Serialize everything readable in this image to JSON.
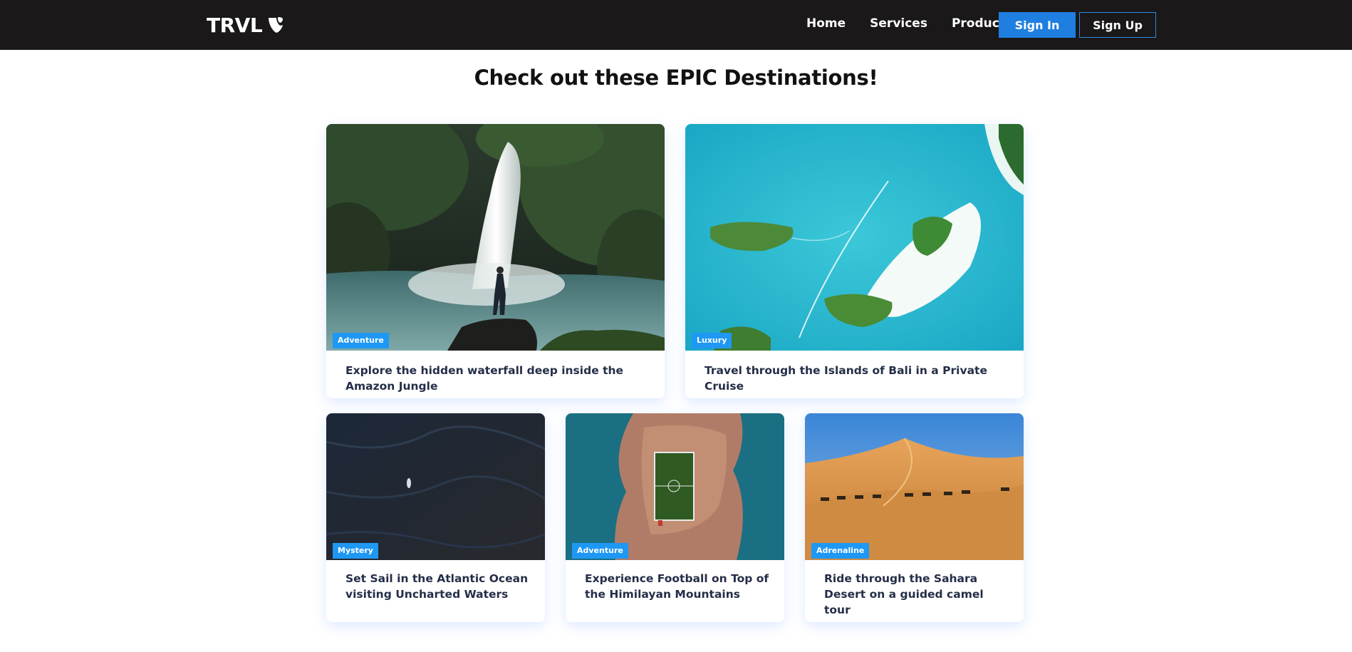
{
  "navbar": {
    "logo_text": "TRVL",
    "logo_icon": "typo3-shield-icon",
    "links": [
      "Home",
      "Services",
      "Products"
    ],
    "sign_in": "Sign In",
    "sign_up": "Sign Up",
    "colors": {
      "background": "#1a1818",
      "accent": "#1f7fe0"
    }
  },
  "main": {
    "heading": "Check out these EPIC Destinations!"
  },
  "cards": [
    {
      "category": "Adventure",
      "text": "Explore the hidden waterfall deep inside the Amazon Jungle",
      "image": "waterfall-jungle"
    },
    {
      "category": "Luxury",
      "text": "Travel through the Islands of Bali in a Private Cruise",
      "image": "bali-islands-aerial"
    },
    {
      "category": "Mystery",
      "text": "Set Sail in the Atlantic Ocean visiting Uncharted Waters",
      "image": "dark-ocean-boat"
    },
    {
      "category": "Adventure",
      "text": "Experience Football on Top of the Himilayan Mountains",
      "image": "island-football-pitch"
    },
    {
      "category": "Adrenaline",
      "text": "Ride through the Sahara Desert on a guided camel tour",
      "image": "sahara-camels"
    }
  ],
  "badge_color": "#1f98f4"
}
